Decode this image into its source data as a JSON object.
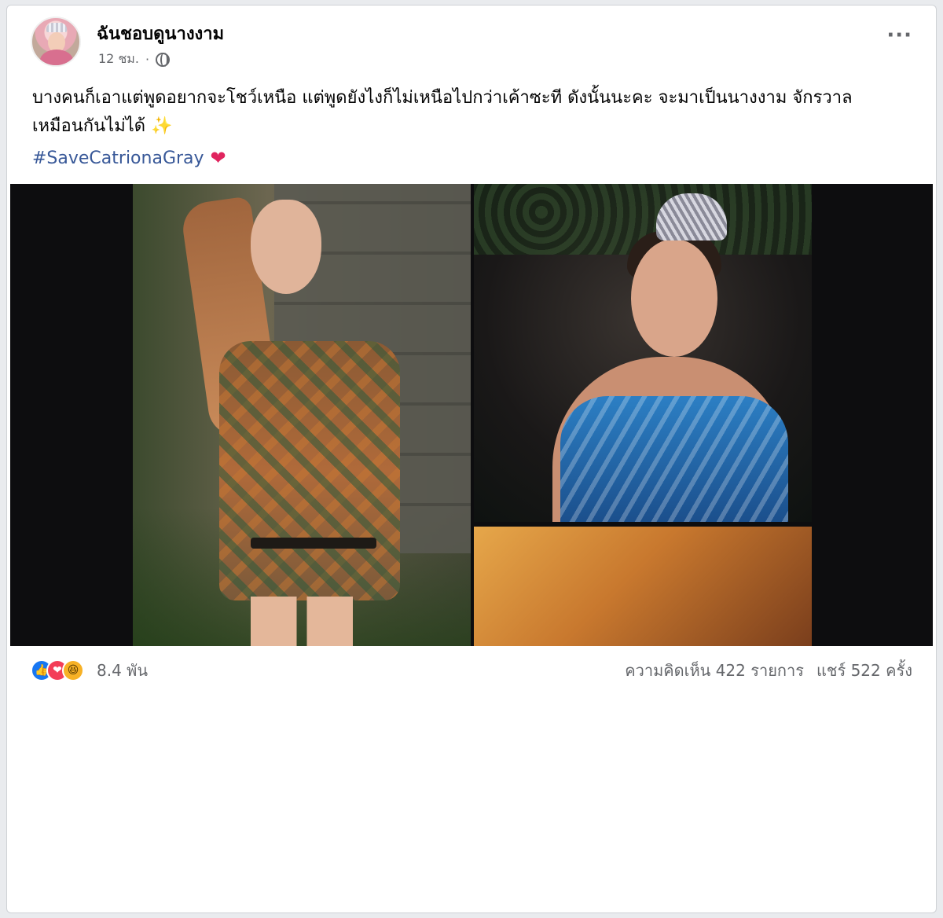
{
  "post": {
    "author": "ฉันชอบดูนางงาม",
    "time": "12 ชม.",
    "privacy_icon": "globe-icon",
    "more_icon": "more-options-icon",
    "text": "บางคนก็เอาแต่พูดอยากจะโชว์เหนือ แต่พูดยังไงก็ไม่เหนือไปกว่าเค้าซะที ดังนั้นนะคะ จะมาเป็นนางงาม จักรวาลเหมือนกันไม่ได้ ✨",
    "hashtag": "#SaveCatrionaGray",
    "hashtag_emoji": "❤"
  },
  "reactions": {
    "icons": [
      "like-icon",
      "love-icon",
      "haha-icon"
    ],
    "count": "8.4 พัน"
  },
  "stats": {
    "comments": "ความคิดเห็น 422 รายการ",
    "shares": "แชร์ 522 ครั้ง"
  },
  "colors": {
    "background": "#e9ebee",
    "card": "#ffffff",
    "link": "#385898",
    "muted": "#65676b",
    "like": "#1877f2",
    "love": "#f33e58",
    "haha": "#f7b125"
  }
}
